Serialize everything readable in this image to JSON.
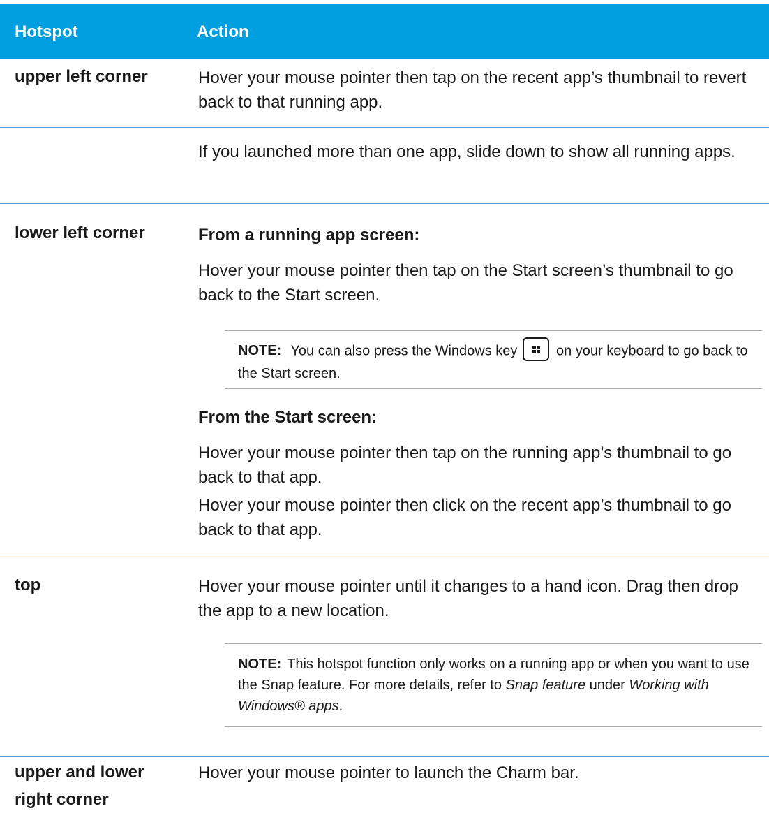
{
  "header": {
    "col1": "Hotspot",
    "col2": "Action"
  },
  "rows": {
    "r1": {
      "hotspot": "upper left corner",
      "action": "Hover your mouse pointer then tap on the recent app’s thumbnail to revert back to that running app."
    },
    "r2": {
      "action": "If you launched more than one app, slide down to show all running apps."
    },
    "r3": {
      "hotspot": "lower left corner",
      "sub1": "From a running app screen:",
      "p1": "Hover your mouse pointer then tap on the Start screen’s thumbnail to go back to the Start screen.",
      "note": {
        "label": "NOTE:",
        "before": "You can also press the Windows key",
        "after": "on your keyboard to go back to the Start screen.",
        "key_icon": "windows-logo"
      },
      "sub2": "From the Start screen:",
      "p2": "Hover your mouse pointer then tap on the running app’s thumbnail to go back to that app.",
      "p3": "Hover your mouse pointer then click on the recent app’s thumbnail to go back to that app."
    },
    "r4": {
      "hotspot": "top",
      "action": "Hover your mouse pointer until it changes to a hand icon. Drag then drop the app to a new location.",
      "note": {
        "label": "NOTE:",
        "t1": "This hotspot function only works on a running app or when you want to use the Snap feature. For more details, refer to ",
        "i1": "Snap feature",
        "t2": " under ",
        "i2": "Working with Windows® apps",
        "t3": "."
      }
    },
    "r5": {
      "hotspot_line1": "upper and lower",
      "hotspot_line2": "right corner",
      "action": "Hover your mouse pointer to launch the Charm bar."
    }
  },
  "colors": {
    "header_bg": "#009fdf",
    "rule": "#5b9fd0"
  }
}
